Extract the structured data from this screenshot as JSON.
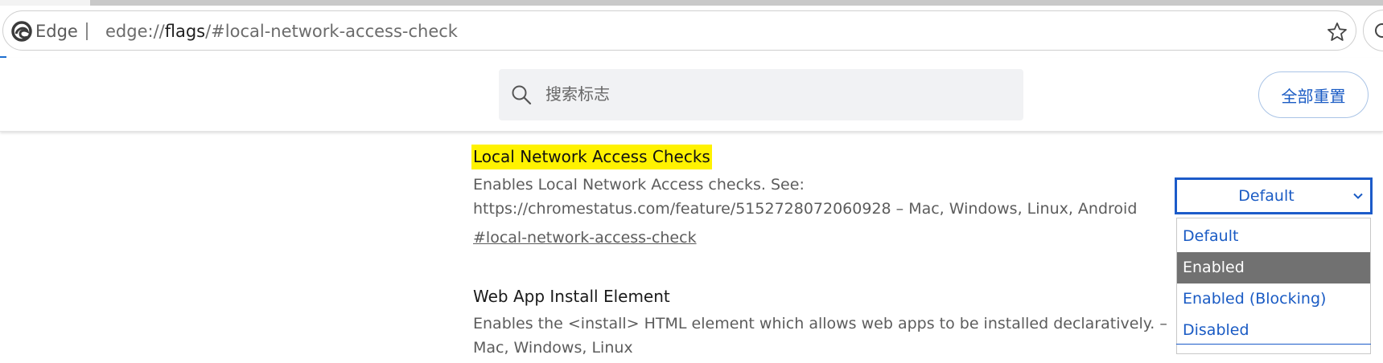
{
  "browser": {
    "brand_label": "Edge",
    "url_scheme": "edge://",
    "url_host": "flags",
    "url_path": "/#local-network-access-check"
  },
  "header": {
    "search_placeholder": "搜索标志",
    "reset_label": "全部重置"
  },
  "flags": [
    {
      "title": "Local Network Access Checks",
      "description_line1": "Enables Local Network Access checks. See:",
      "description_line2": "https://chromestatus.com/feature/5152728072060928 – Mac, Windows, Linux, Android",
      "anchor": "#local-network-access-check",
      "select_value": "Default",
      "options": [
        "Default",
        "Enabled",
        "Enabled (Blocking)",
        "Disabled"
      ],
      "highlighted_option": "Enabled"
    },
    {
      "title": "Web App Install Element",
      "description_line1": "Enables the <install> HTML element which allows web apps to be installed declaratively. –",
      "description_line2": "Mac, Windows, Linux"
    }
  ],
  "colors": {
    "accent": "#1a5bc4",
    "highlight": "#fff200",
    "selected_option_bg": "#717171"
  },
  "icons": {
    "brand": "edge-logo-icon",
    "favorite": "star-icon",
    "search": "search-icon",
    "select": "chevron-down-icon"
  }
}
